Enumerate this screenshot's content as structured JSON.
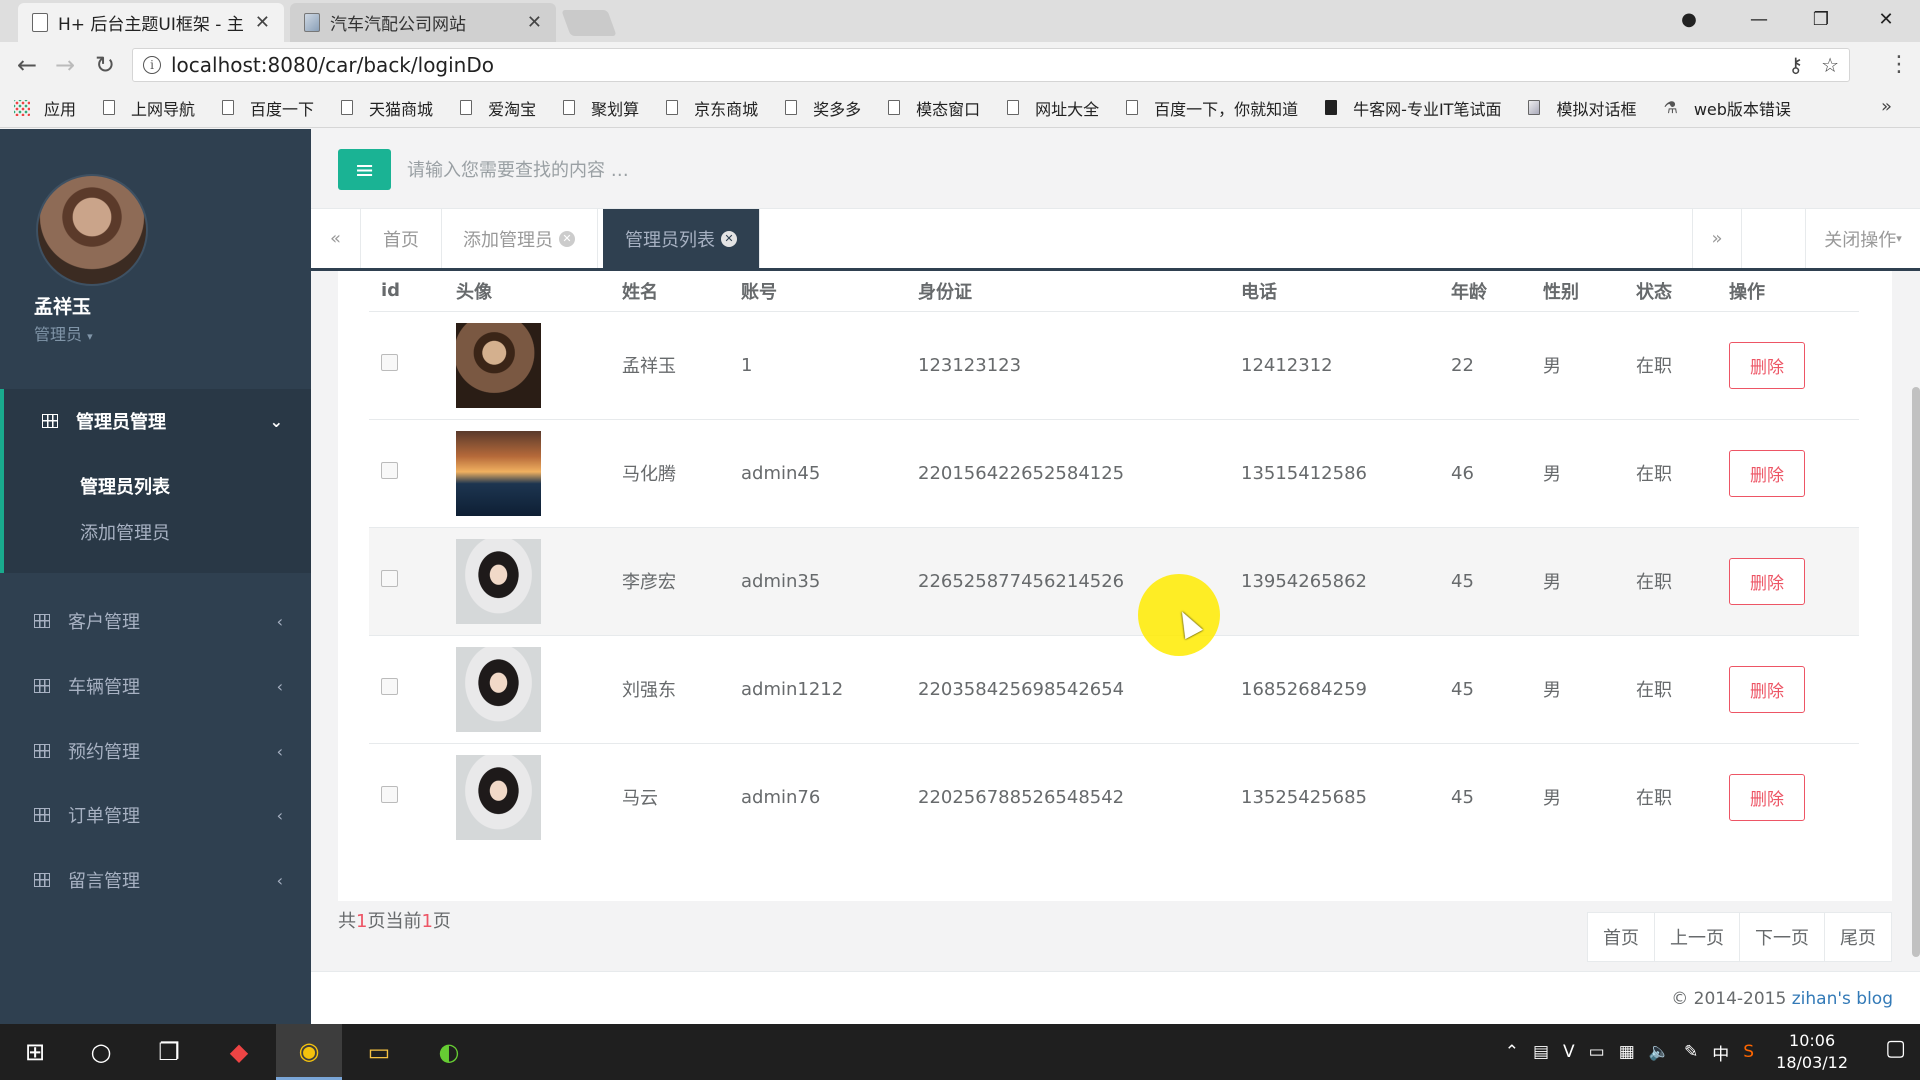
{
  "browser": {
    "tabs": [
      {
        "title": "H+ 后台主题UI框架 - 主",
        "active": true
      },
      {
        "title": "汽车汽配公司网站",
        "active": false
      }
    ],
    "url": "localhost:8080/car/back/loginDo",
    "bookmarks": [
      "应用",
      "上网导航",
      "百度一下",
      "天猫商城",
      "爱淘宝",
      "聚划算",
      "京东商城",
      "奖多多",
      "模态窗口",
      "网址大全",
      "百度一下，你就知道",
      "牛客网-专业IT笔试面",
      "模拟对话框",
      "web版本错误"
    ]
  },
  "sidebar": {
    "user_name": "孟祥玉",
    "user_role": "管理员",
    "menu": [
      {
        "label": "管理员管理",
        "expanded": true
      },
      {
        "label": "客户管理"
      },
      {
        "label": "车辆管理"
      },
      {
        "label": "预约管理"
      },
      {
        "label": "订单管理"
      },
      {
        "label": "留言管理"
      }
    ],
    "submenu": [
      {
        "label": "管理员列表",
        "active": true
      },
      {
        "label": "添加管理员"
      }
    ]
  },
  "header": {
    "search_placeholder": "请输入您需要查找的内容 …"
  },
  "page_tabs": {
    "items": [
      {
        "label": "首页"
      },
      {
        "label": "添加管理员"
      },
      {
        "label": "管理员列表",
        "active": true
      }
    ],
    "close_ops": "关闭操作"
  },
  "table": {
    "columns": [
      "id",
      "头像",
      "姓名",
      "账号",
      "身份证",
      "电话",
      "年龄",
      "性别",
      "状态",
      "操作"
    ],
    "rows": [
      {
        "name": "孟祥玉",
        "account": "1",
        "idcard": "123123123",
        "phone": "12412312",
        "age": "22",
        "gender": "男",
        "status": "在职",
        "action": "删除"
      },
      {
        "name": "马化腾",
        "account": "admin45",
        "idcard": "220156422652584125",
        "phone": "13515412586",
        "age": "46",
        "gender": "男",
        "status": "在职",
        "action": "删除"
      },
      {
        "name": "李彦宏",
        "account": "admin35",
        "idcard": "226525877456214526",
        "phone": "13954265862",
        "age": "45",
        "gender": "男",
        "status": "在职",
        "action": "删除"
      },
      {
        "name": "刘强东",
        "account": "admin1212",
        "idcard": "220358425698542654",
        "phone": "16852684259",
        "age": "45",
        "gender": "男",
        "status": "在职",
        "action": "删除"
      },
      {
        "name": "马云",
        "account": "admin76",
        "idcard": "220256788526548542",
        "phone": "13525425685",
        "age": "45",
        "gender": "男",
        "status": "在职",
        "action": "删除"
      }
    ]
  },
  "pager": {
    "info_prefix": "共",
    "total": "1",
    "info_mid": "页当前",
    "current": "1",
    "info_suffix": "页",
    "first": "首页",
    "prev": "上一页",
    "next": "下一页",
    "last": "尾页"
  },
  "footer": {
    "copyright": "© 2014-2015 ",
    "link": "zihan's blog"
  },
  "taskbar": {
    "time": "10:06",
    "date": "18/03/12",
    "ime": "中"
  },
  "colors": {
    "sidebar_bg": "#2f4050",
    "accent": "#1ab394",
    "danger": "#ed5565"
  }
}
